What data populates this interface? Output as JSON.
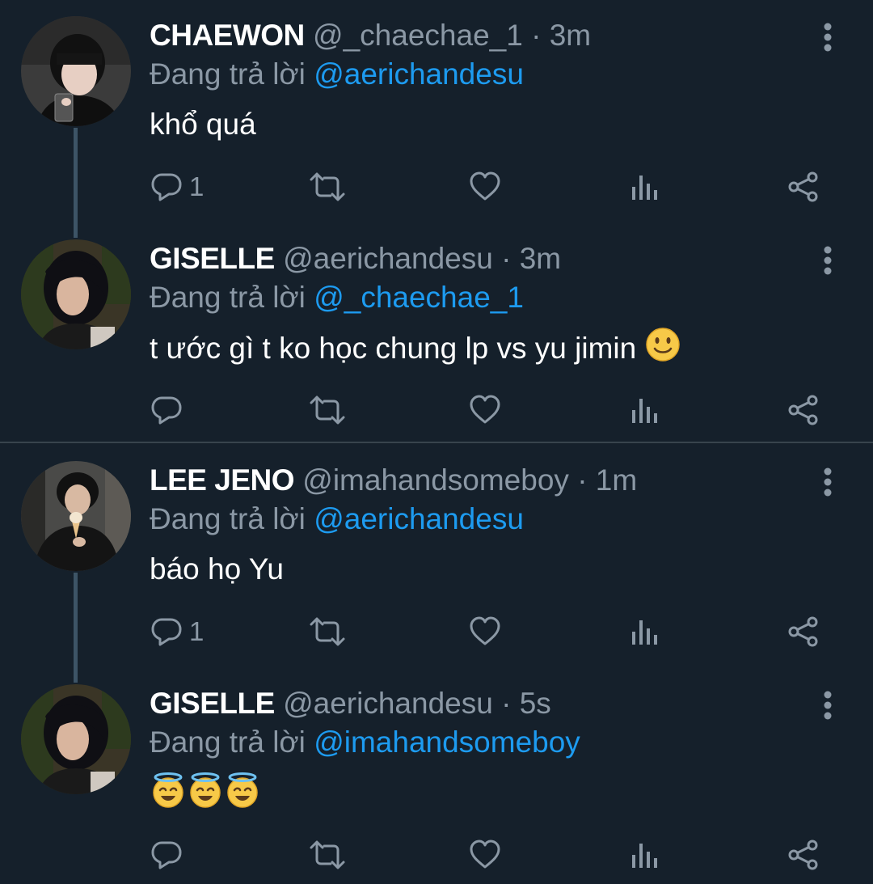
{
  "tweets": [
    {
      "name": "CHAEWON",
      "handle": "@_chaechae_1",
      "separator": "·",
      "time": "3m",
      "replying_prefix": "Đang trả lời",
      "replying_to": "@aerichandesu",
      "text": "khổ quá",
      "reply_count": "1"
    },
    {
      "name": "GISELLE",
      "handle": "@aerichandesu",
      "separator": "·",
      "time": "3m",
      "replying_prefix": "Đang trả lời",
      "replying_to": "@_chaechae_1",
      "text": "t ước gì t ko học chung lp vs yu jimin",
      "reply_count": ""
    },
    {
      "name": "LEE JENO",
      "handle": "@imahandsomeboy",
      "separator": "·",
      "time": "1m",
      "replying_prefix": "Đang trả lời",
      "replying_to": "@aerichandesu",
      "text": "báo họ Yu",
      "reply_count": "1"
    },
    {
      "name": "GISELLE",
      "handle": "@aerichandesu",
      "separator": "·",
      "time": "5s",
      "replying_prefix": "Đang trả lời",
      "replying_to": "@imahandsomeboy",
      "text": "",
      "reply_count": ""
    }
  ],
  "colors": {
    "background": "#15202b",
    "text_primary": "#ffffff",
    "text_secondary": "#8b98a5",
    "accent": "#1d9bf0",
    "divider": "#38444d",
    "thread_line": "#3d5466"
  },
  "icons": {
    "reply": "speech-bubble-icon",
    "retweet": "retweet-icon",
    "like": "heart-icon",
    "analytics": "bar-chart-icon",
    "share": "share-icon",
    "more": "vertical-dots-icon",
    "smile_emoji": "slightly-smiling-face-emoji",
    "halo_emoji": "smiling-face-with-halo-emoji"
  }
}
